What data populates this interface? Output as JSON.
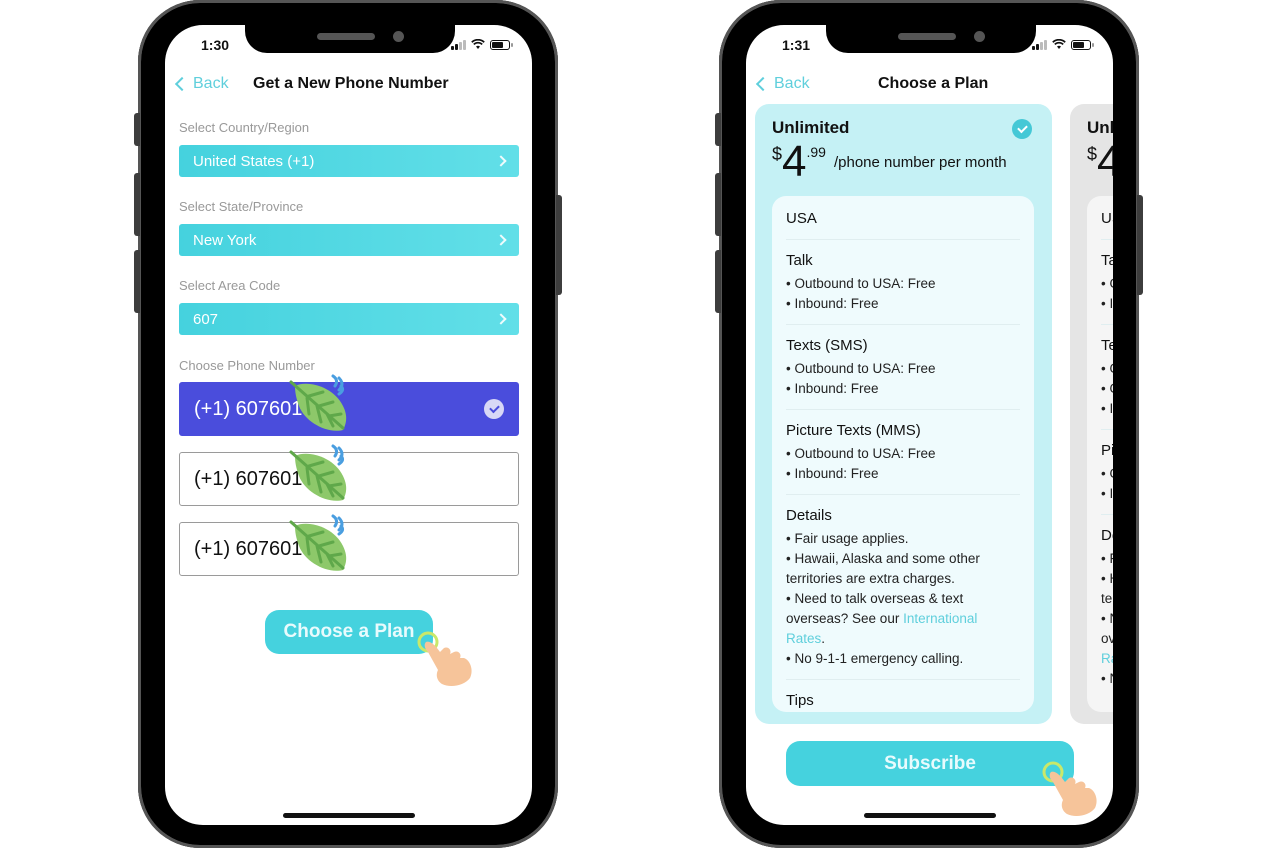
{
  "colors": {
    "accent": "#45d2de",
    "selected_number": "#4a4ddc",
    "link": "#5fcfdc",
    "plan_active_bg": "#c5f1f5",
    "plan_inactive_bg": "#e5e5e5"
  },
  "left_phone": {
    "status": {
      "time": "1:30",
      "icons": [
        "signal-icon",
        "wifi-icon",
        "battery-icon"
      ]
    },
    "nav": {
      "back_label": "Back",
      "title": "Get a New Phone Number"
    },
    "fields": [
      {
        "label": "Select Country/Region",
        "value": "United States (+1)"
      },
      {
        "label": "Select State/Province",
        "value": "New York"
      },
      {
        "label": "Select Area Code",
        "value": "607"
      }
    ],
    "numbers_label": "Choose Phone Number",
    "numbers": [
      {
        "value": "(+1) 607601",
        "selected": true
      },
      {
        "value": "(+1) 607601",
        "selected": false
      },
      {
        "value": "(+1) 607601",
        "selected": false
      }
    ],
    "cta_label": "Choose a Plan"
  },
  "right_phone": {
    "status": {
      "time": "1:31",
      "icons": [
        "signal-icon",
        "wifi-icon",
        "battery-icon"
      ]
    },
    "nav": {
      "back_label": "Back",
      "title": "Choose a Plan"
    },
    "plans": [
      {
        "name": "Unlimited",
        "currency": "$",
        "price_whole": "4",
        "price_cents": ".99",
        "period": "/phone number per month",
        "selected": true,
        "sections": [
          {
            "title": "USA",
            "lines": []
          },
          {
            "title": "Talk",
            "lines": [
              "• Outbound to USA: Free",
              "• Inbound: Free"
            ]
          },
          {
            "title": "Texts (SMS)",
            "lines": [
              "• Outbound to USA: Free",
              "• Inbound: Free"
            ]
          },
          {
            "title": "Picture Texts (MMS)",
            "lines": [
              "• Outbound to USA: Free",
              "• Inbound: Free"
            ]
          },
          {
            "title": "Details",
            "lines": [
              "• Fair usage applies.",
              "• Hawaii, Alaska and some other territories are extra charges."
            ],
            "rates_prefix": "• Need to talk overseas & text overseas? See our ",
            "rates_link": "International Rates",
            "rates_suffix": ".",
            "last_line": "• No 9-1-1 emergency calling."
          },
          {
            "title": "Tips",
            "lines": []
          }
        ]
      },
      {
        "name": "Unl",
        "currency": "$",
        "price_whole": "4",
        "selected": false,
        "sections": [
          {
            "title": "US",
            "lines": []
          },
          {
            "title": "Ta",
            "lines": [
              "• O",
              "• I"
            ]
          },
          {
            "title": "Te",
            "lines": [
              "• O",
              "• O",
              "• I"
            ]
          },
          {
            "title": "Pi",
            "lines": [
              "• O",
              "• I"
            ]
          },
          {
            "title": "De",
            "lines": [
              "• F",
              "• H",
              "te",
              "• N",
              "ov"
            ],
            "link_frag": "Ra",
            "last_line": "• N"
          }
        ]
      }
    ],
    "subscribe_label": "Subscribe"
  }
}
